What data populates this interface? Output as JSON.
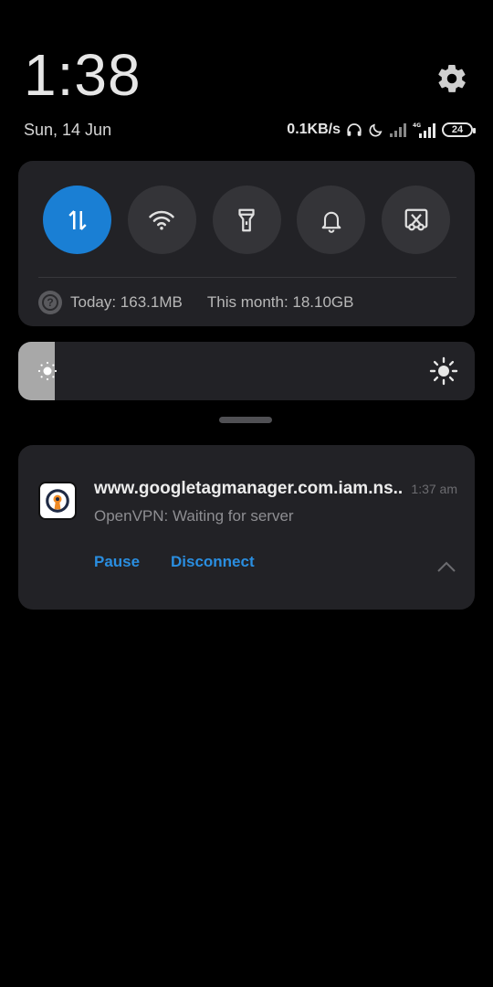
{
  "header": {
    "time": "1:38",
    "date": "Sun, 14 Jun",
    "net_speed": "0.1KB/s",
    "battery": "24"
  },
  "toggles": [
    {
      "name": "mobile-data",
      "icon": "data-transfer-icon",
      "active": true
    },
    {
      "name": "wifi",
      "icon": "wifi-icon",
      "active": false
    },
    {
      "name": "flashlight",
      "icon": "flashlight-icon",
      "active": false
    },
    {
      "name": "sound",
      "icon": "bell-icon",
      "active": false
    },
    {
      "name": "screenshot",
      "icon": "screenshot-scissors-icon",
      "active": false
    }
  ],
  "data_usage": {
    "today": "Today: 163.1MB",
    "month": "This month: 18.10GB"
  },
  "brightness": {
    "level": 0.08
  },
  "notification": {
    "title": "www.googletagmanager.com.iam.ns..",
    "time": "1:37 am",
    "text": "OpenVPN: Waiting for server",
    "actions": {
      "pause": "Pause",
      "disconnect": "Disconnect"
    }
  },
  "colors": {
    "background": "#000000",
    "card": "#222226",
    "accent": "#1a7fd4",
    "action_text": "#2a8ee0"
  }
}
